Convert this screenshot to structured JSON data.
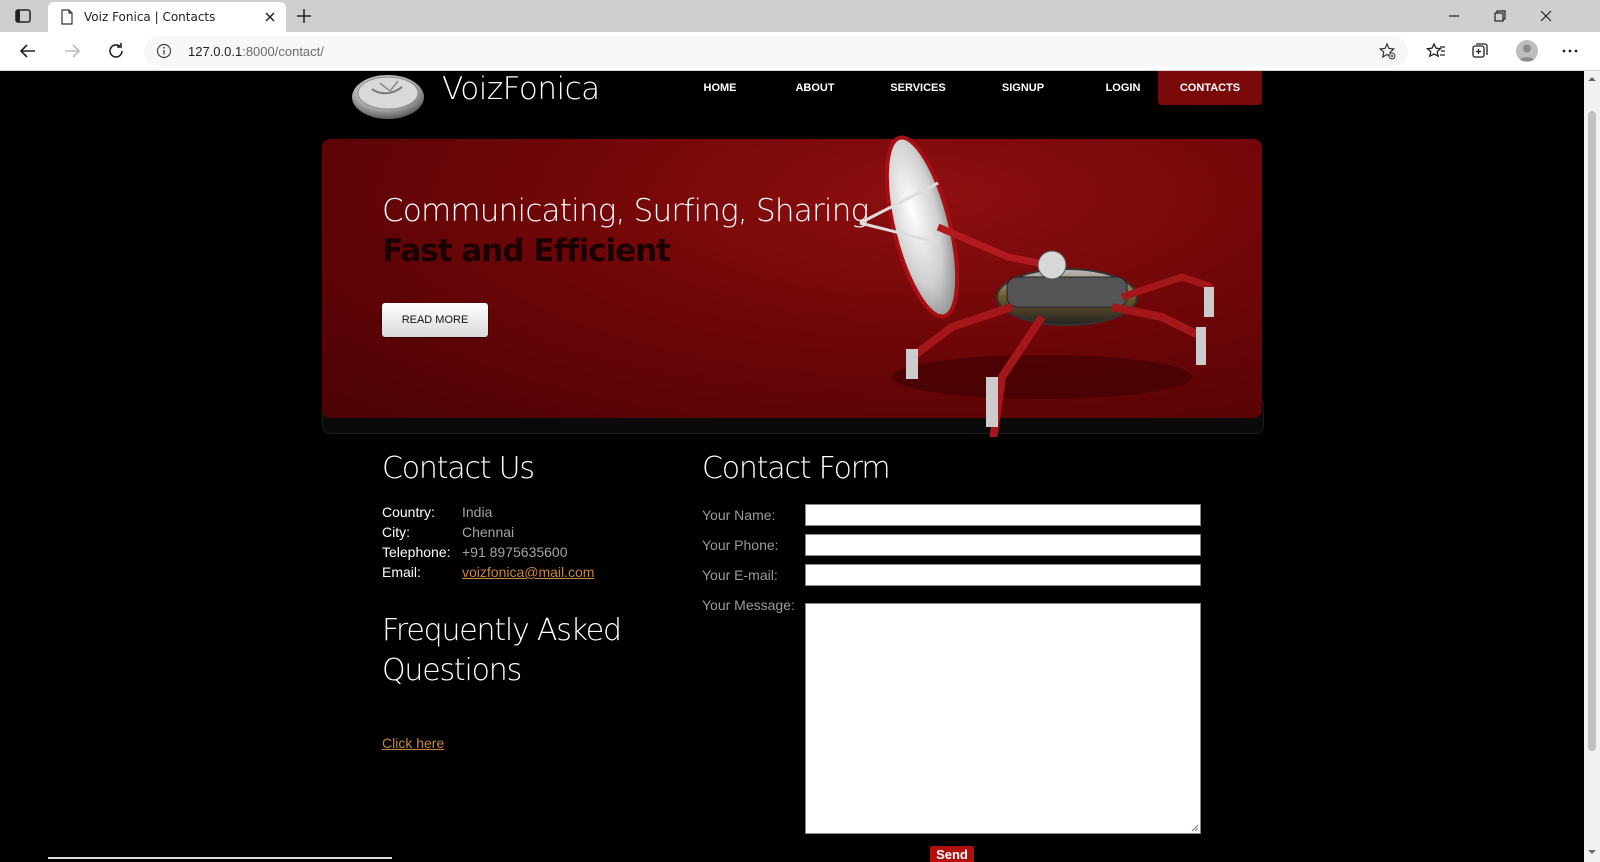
{
  "browser": {
    "tab_title": "Voiz Fonica | Contacts",
    "url_host": "127.0.0.1",
    "url_rest": ":8000/contact/"
  },
  "site": {
    "brand": "VoizFonica",
    "nav": [
      "HOME",
      "ABOUT",
      "SERVICES",
      "SIGNUP",
      "LOGIN",
      "CONTACTS"
    ],
    "active_nav": "CONTACTS"
  },
  "banner": {
    "headline": "Communicating, Surfing, Sharing",
    "subheadline": "Fast and Efficient",
    "button": "READ MORE"
  },
  "contact": {
    "heading": "Contact Us",
    "rows": [
      {
        "label": "Country:",
        "value": "India"
      },
      {
        "label": "City:",
        "value": "Chennai"
      },
      {
        "label": "Telephone:",
        "value": "+91 8975635600"
      },
      {
        "label": "Email:",
        "value": "voizfonica@mail.com"
      }
    ]
  },
  "faq": {
    "heading_line1": "Frequently Asked",
    "heading_line2": "Questions",
    "link": "Click here"
  },
  "form": {
    "heading": "Contact Form",
    "name_label": "Your Name:",
    "phone_label": "Your Phone:",
    "email_label": "Your E-mail:",
    "message_label": "Your Message:",
    "name_value": "",
    "phone_value": "",
    "email_value": "",
    "message_value": "",
    "send": "Send"
  },
  "colors": {
    "accent_red": "#7a0a0a",
    "link_orange": "#c8863d",
    "send_red": "#b30f0f"
  }
}
